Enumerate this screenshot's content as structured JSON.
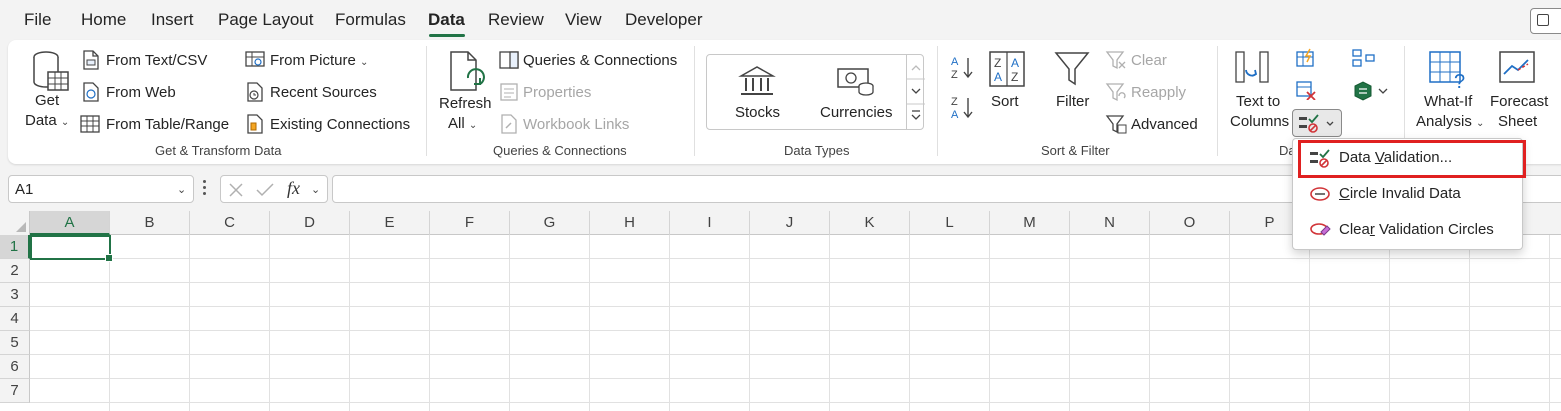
{
  "tabs": [
    "File",
    "Home",
    "Insert",
    "Page Layout",
    "Formulas",
    "Data",
    "Review",
    "View",
    "Developer"
  ],
  "active_tab": "Data",
  "colors": {
    "accent": "#217346",
    "highlight": "#e02020",
    "disabled": "#a6a6a6"
  },
  "groups": {
    "get_transform": {
      "label": "Get & Transform Data",
      "get_data_line1": "Get",
      "get_data_line2": "Data",
      "from_text_csv": "From Text/CSV",
      "from_web": "From Web",
      "from_table_range": "From Table/Range",
      "from_picture": "From Picture",
      "recent_sources": "Recent Sources",
      "existing_connections": "Existing Connections"
    },
    "queries": {
      "label": "Queries & Connections",
      "refresh_line1": "Refresh",
      "refresh_line2": "All",
      "queries_connections": "Queries & Connections",
      "properties": "Properties",
      "workbook_links": "Workbook Links"
    },
    "data_types": {
      "label": "Data Types",
      "stocks": "Stocks",
      "currencies": "Currencies"
    },
    "sort_filter": {
      "label": "Sort & Filter",
      "sort": "Sort",
      "filter": "Filter",
      "clear": "Clear",
      "reapply": "Reapply",
      "advanced": "Advanced"
    },
    "data_tools": {
      "label": "Da",
      "text_to_columns_line1": "Text to",
      "text_to_columns_line2": "Columns"
    },
    "forecast": {
      "what_if_line1": "What-If",
      "what_if_line2": "Analysis",
      "forecast_line1": "Forecast",
      "forecast_line2": "Sheet"
    }
  },
  "name_box": "A1",
  "fx_label": "fx",
  "columns": [
    "A",
    "B",
    "C",
    "D",
    "E",
    "F",
    "G",
    "H",
    "I",
    "J",
    "K",
    "L",
    "M",
    "N",
    "O",
    "P"
  ],
  "rows": [
    "1",
    "2",
    "3",
    "4",
    "5",
    "6",
    "7"
  ],
  "dropdown": {
    "items": [
      {
        "pre": "Data ",
        "ul": "V",
        "post": "alidation..."
      },
      {
        "pre": "",
        "ul": "C",
        "post": "ircle Invalid Data"
      },
      {
        "pre": "Clea",
        "ul": "r",
        "post": " Validation Circles"
      }
    ]
  }
}
